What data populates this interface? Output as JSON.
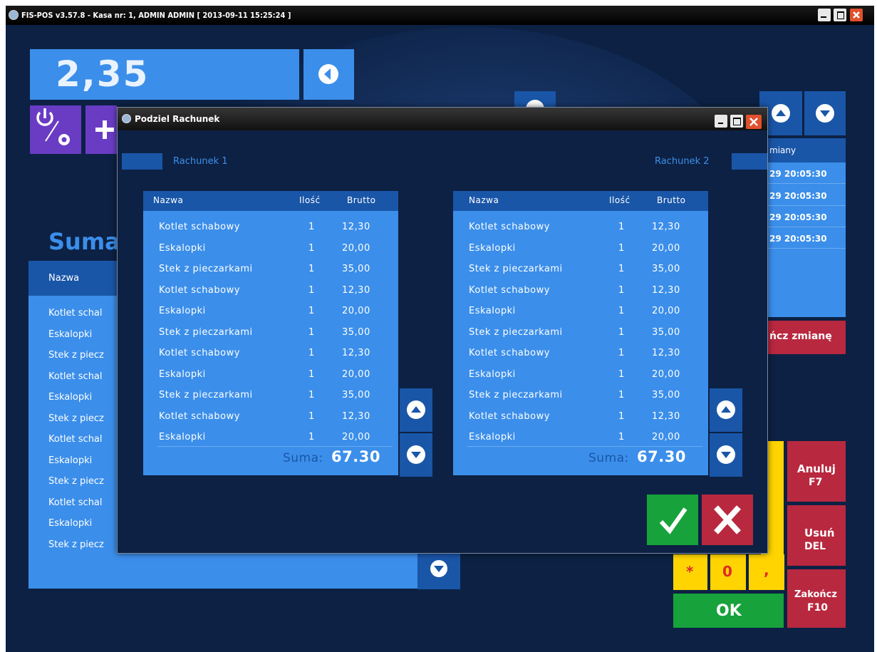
{
  "window": {
    "title": "FIS-POS v3.57.8 - Kasa nr: 1, ADMIN ADMIN [ 2013-09-11 15:25:24 ]"
  },
  "amount_display": "2,35",
  "suma_label": "Suma",
  "bg_table": {
    "header": "Nazwa",
    "items": [
      "Kotlet schal",
      "Eskalopki",
      "Stek z piecz",
      "Kotlet schal",
      "Eskalopki",
      "Stek z piecz",
      "Kotlet schal",
      "Eskalopki",
      "Stek z piecz",
      "Kotlet schal",
      "Eskalopki",
      "Stek z piecz"
    ]
  },
  "right_panel": {
    "header": "miany",
    "times": [
      "29 20:05:30",
      "29 20:05:30",
      "29 20:05:30",
      "29 20:05:30"
    ],
    "close_shift": "ńcz zmianę"
  },
  "keypad": {
    "star": "*",
    "zero": "0",
    "comma": ",",
    "ok": "OK",
    "cancel": [
      "Anuluj",
      "F7"
    ],
    "delete": [
      "Usuń",
      "DEL"
    ],
    "finish": [
      "Zakończ",
      "F10"
    ]
  },
  "dialog": {
    "title": "Podziel Rachunek",
    "bill1_label": "Rachunek 1",
    "bill2_label": "Rachunek 2",
    "columns": {
      "name": "Nazwa",
      "qty": "Ilość",
      "gross": "Brutto"
    },
    "bill1": {
      "rows": [
        [
          "Kotlet schabowy",
          "1",
          "12,30"
        ],
        [
          "Eskalopki",
          "1",
          "20,00"
        ],
        [
          "Stek z pieczarkami",
          "1",
          "35,00"
        ],
        [
          "Kotlet schabowy",
          "1",
          "12,30"
        ],
        [
          "Eskalopki",
          "1",
          "20,00"
        ],
        [
          "Stek z pieczarkami",
          "1",
          "35,00"
        ],
        [
          "Kotlet schabowy",
          "1",
          "12,30"
        ],
        [
          "Eskalopki",
          "1",
          "20,00"
        ],
        [
          "Stek z pieczarkami",
          "1",
          "35,00"
        ],
        [
          "Kotlet schabowy",
          "1",
          "12,30"
        ],
        [
          "Eskalopki",
          "1",
          "20,00"
        ]
      ],
      "sum_label": "Suma:",
      "sum_value": "67.30"
    },
    "bill2": {
      "rows": [
        [
          "Kotlet schabowy",
          "1",
          "12,30"
        ],
        [
          "Eskalopki",
          "1",
          "20,00"
        ],
        [
          "Stek z pieczarkami",
          "1",
          "35,00"
        ],
        [
          "Kotlet schabowy",
          "1",
          "12,30"
        ],
        [
          "Eskalopki",
          "1",
          "20,00"
        ],
        [
          "Stek z pieczarkami",
          "1",
          "35,00"
        ],
        [
          "Kotlet schabowy",
          "1",
          "12,30"
        ],
        [
          "Eskalopki",
          "1",
          "20,00"
        ],
        [
          "Stek z pieczarkami",
          "1",
          "35,00"
        ],
        [
          "Kotlet schabowy",
          "1",
          "12,30"
        ],
        [
          "Eskalopki",
          "1",
          "20,00"
        ]
      ],
      "sum_label": "Suma:",
      "sum_value": "67.30"
    }
  },
  "icons": {
    "power_settings": "power-settings-icon",
    "add": "plus-icon",
    "back": "back-arrow-icon",
    "up": "arrow-up-icon",
    "down": "arrow-down-icon",
    "confirm": "check-icon",
    "cancel": "x-icon"
  },
  "colors": {
    "background": "#0c2144",
    "panel_blue": "#3b8fea",
    "header_blue": "#1a56a8",
    "confirm_green": "#18a23b",
    "cancel_red": "#b8283f",
    "keypad_yellow": "#ffd400",
    "settings_purple": "#6a3cc4"
  }
}
